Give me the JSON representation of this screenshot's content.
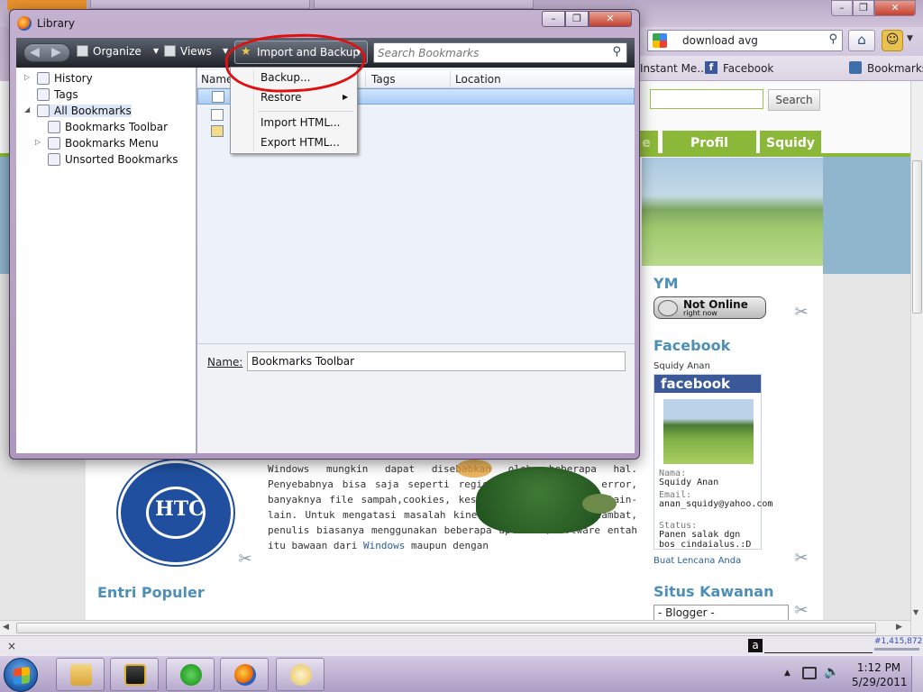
{
  "firefox": {
    "search_text": "download avg",
    "bookmarks_bar": {
      "instant": "Instant Me...",
      "facebook": "Facebook",
      "bookmarks": "Bookmarks"
    }
  },
  "page": {
    "search_button": "Search",
    "tabs": [
      "e",
      "Profil Penulis",
      "Squidy"
    ],
    "ym": {
      "heading": "YM",
      "status": "Not Online",
      "substatus": "right now"
    },
    "facebook": {
      "heading": "Facebook",
      "owner": "Squidy Anan",
      "logo": "facebook",
      "name_label": "Nama:",
      "name_value": "Squidy Anan",
      "email_label": "Email:",
      "email_value": "anan_squidy@yahoo.com",
      "status_label": "Status:",
      "status_value": "Panen salak dgn bos cindaialus.:D",
      "badge_link": "Buat Lencana Anda"
    },
    "situs_heading": "Situs Kawanan",
    "blogger_select": "- Blogger -",
    "entri_heading": "Entri Populer",
    "htc_letters": "HTC",
    "article": {
      "text": "Windows mungkin dapat disebabkan oleh beberapa hal. Penyebabnya bisa saja seperti registry nya ada yang error, banyaknya file sampah,cookies, kesalahan aplikasi, dan lain-lain. Untuk mengatasi masalah kinerja Windows yang melambat, penulis biasanya menggunakan beberapa aplikasi/software entah itu bawaan dari",
      "link": "Windows",
      "tail": "maupun dengan"
    }
  },
  "statusbar": {
    "close": "×",
    "alexa_rank": "#1,415,872"
  },
  "taskbar": {
    "time": "1:12 PM",
    "date": "5/29/2011"
  },
  "library": {
    "title": "Library",
    "toolbar": {
      "organize": "Organize",
      "views": "Views",
      "import_backup": "Import and Backup",
      "search_placeholder": "Search Bookmarks"
    },
    "tree": [
      "History",
      "Tags",
      "All Bookmarks",
      "Bookmarks Toolbar",
      "Bookmarks Menu",
      "Unsorted Bookmarks"
    ],
    "columns": [
      "Name",
      "Tags",
      "Location"
    ],
    "details": {
      "name_label": "Name:",
      "name_value": "Bookmarks Toolbar"
    },
    "menu": {
      "backup": "Backup...",
      "restore": "Restore",
      "import_html": "Import HTML...",
      "export_html": "Export HTML..."
    }
  },
  "colors": {
    "accent_green": "#8bb838",
    "heading_blue": "#4d8fb7",
    "annotation_red": "#e01010"
  }
}
